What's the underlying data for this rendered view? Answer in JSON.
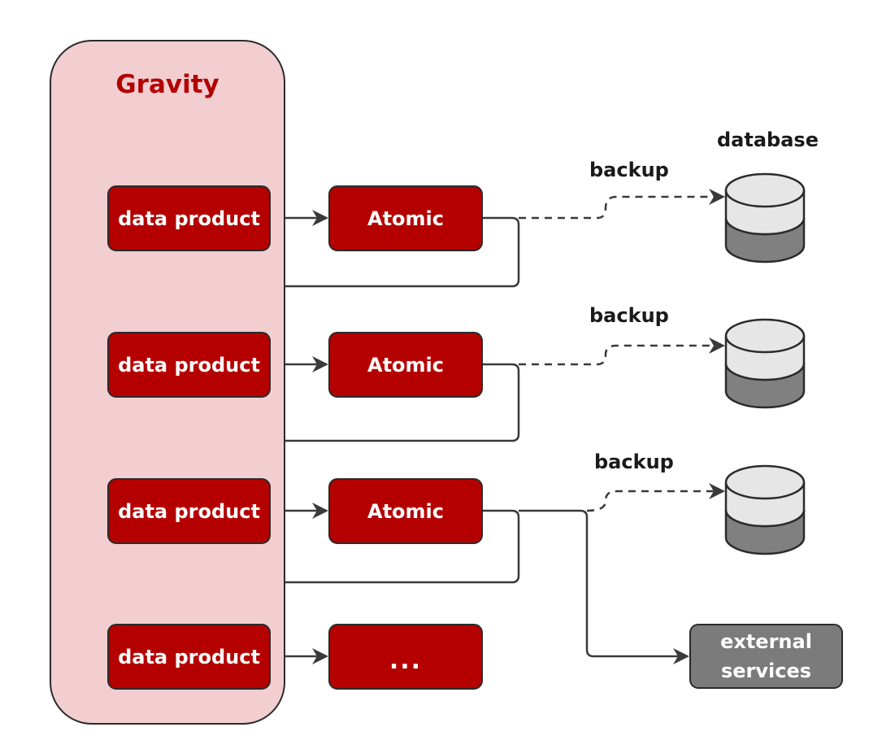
{
  "gravity": {
    "title": "Gravity"
  },
  "database_label": "database",
  "rows": [
    {
      "product": "data product",
      "node": "Atomic",
      "backup": "backup"
    },
    {
      "product": "data product",
      "node": "Atomic",
      "backup": "backup"
    },
    {
      "product": "data product",
      "node": "Atomic",
      "backup": "backup"
    },
    {
      "product": "data product",
      "node": "..."
    }
  ],
  "external": {
    "line1": "external",
    "line2": "services"
  },
  "colors": {
    "node_red": "#b50000",
    "gravity_fill": "#f2ced1",
    "gravity_title": "#b30000",
    "external_gray": "#7b7b7b",
    "db_top": "#e6e6e6",
    "db_bottom": "#808080",
    "stroke": "#2b2b2b"
  },
  "icons": [
    "database-icon",
    "arrow-icon"
  ]
}
